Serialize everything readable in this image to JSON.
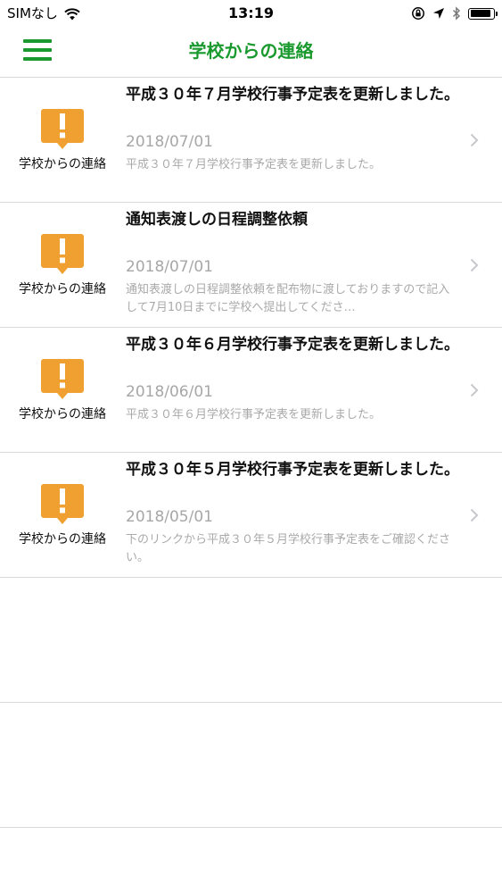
{
  "status_bar": {
    "carrier": "SIMなし",
    "time": "13:19",
    "battery_level": 0.9
  },
  "nav": {
    "title": "学校からの連絡",
    "menu_icon": "hamburger-menu-icon"
  },
  "colors": {
    "accent": "#1a9a2e",
    "alert_icon": "#f0a030",
    "secondary_text": "#a7a7a7",
    "divider": "#d9d9d9"
  },
  "items": [
    {
      "category": "学校からの連絡",
      "title": "平成３０年７月学校行事予定表を更新しました。",
      "date": "2018/07/01",
      "description": "平成３０年７月学校行事予定表を更新しました。"
    },
    {
      "category": "学校からの連絡",
      "title": "通知表渡しの日程調整依頼",
      "date": "2018/07/01",
      "description": "通知表渡しの日程調整依頼を配布物に渡しておりますので記入して7月10日までに学校へ提出してくださ…"
    },
    {
      "category": "学校からの連絡",
      "title": "平成３０年６月学校行事予定表を更新しました。",
      "date": "2018/06/01",
      "description": "平成３０年６月学校行事予定表を更新しました。"
    },
    {
      "category": "学校からの連絡",
      "title": "平成３０年５月学校行事予定表を更新しました。",
      "date": "2018/05/01",
      "description": "下のリンクから平成３０年５月学校行事予定表をご確認ください。"
    }
  ]
}
